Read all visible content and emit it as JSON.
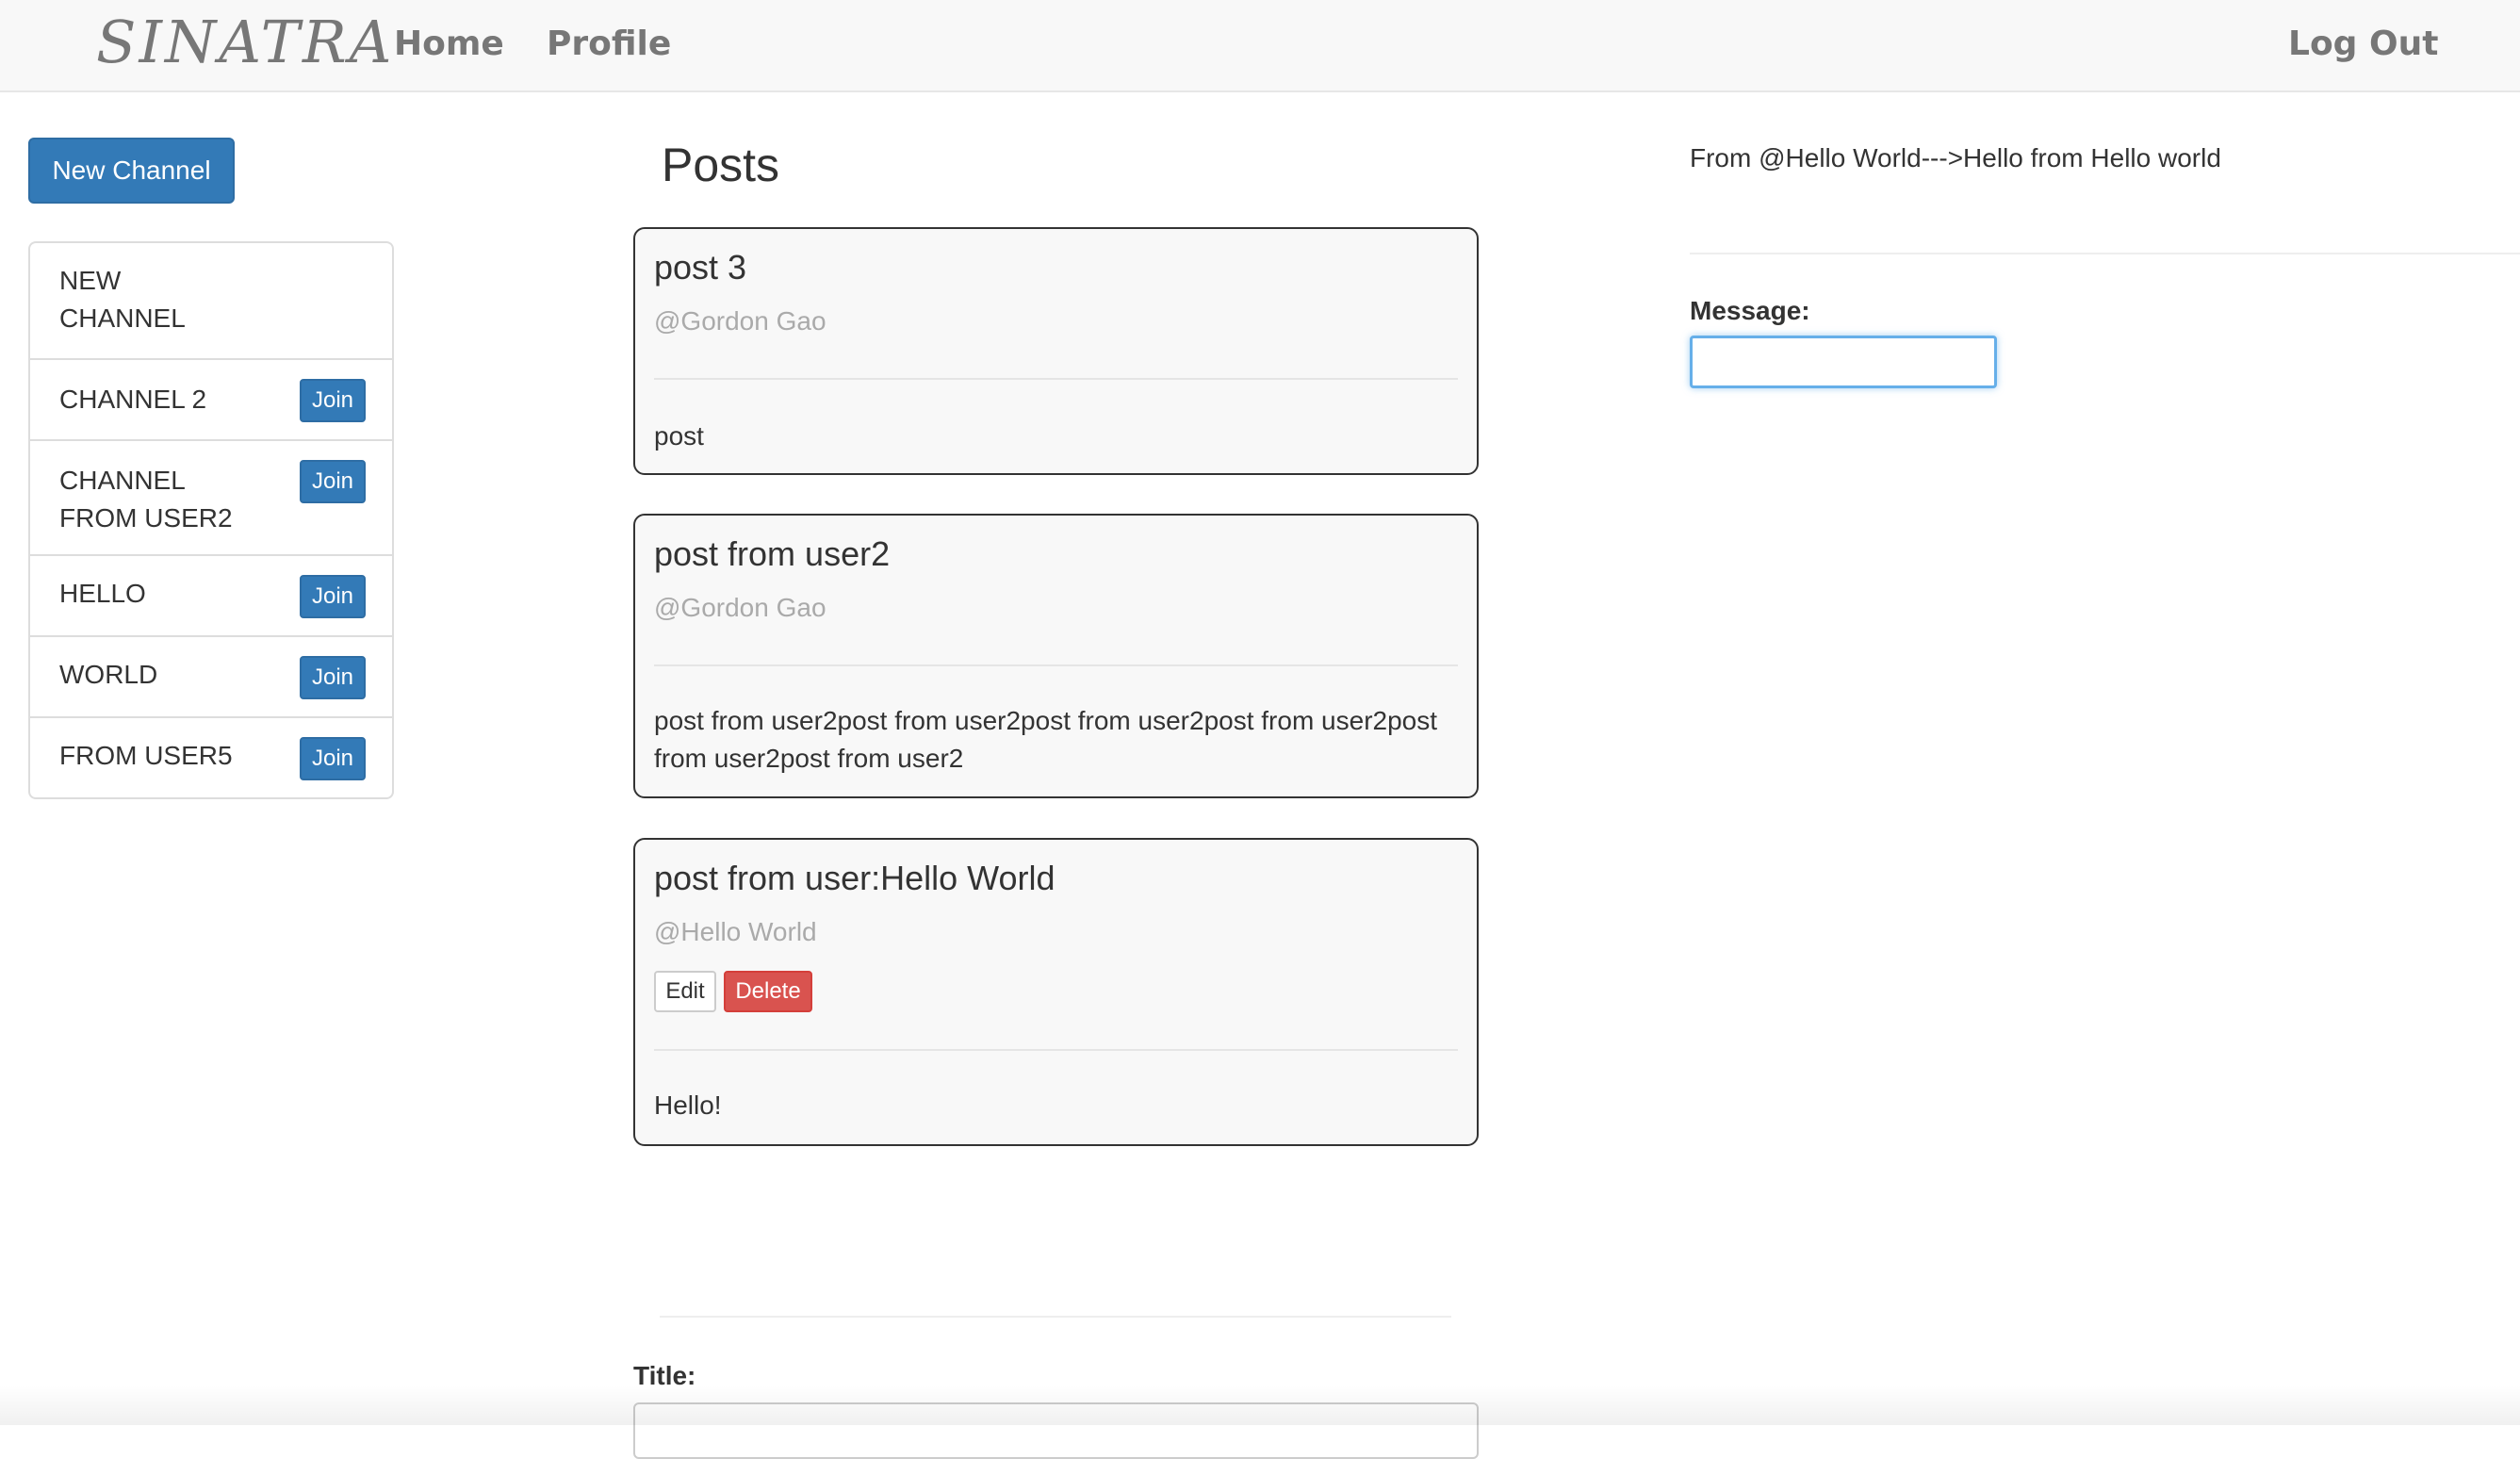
{
  "navbar": {
    "brand": "SINATRA",
    "home_label": "Home",
    "profile_label": "Profile",
    "logout_label": "Log Out"
  },
  "sidebar": {
    "new_channel_label": "New Channel",
    "channels": [
      {
        "name": "NEW\nCHANNEL",
        "join_label": ""
      },
      {
        "name": "CHANNEL 2",
        "join_label": "Join"
      },
      {
        "name": "CHANNEL\nFROM USER2",
        "join_label": "Join"
      },
      {
        "name": "HELLO",
        "join_label": "Join"
      },
      {
        "name": "WORLD",
        "join_label": "Join"
      },
      {
        "name": "FROM USER5",
        "join_label": "Join"
      }
    ]
  },
  "main": {
    "heading": "Posts",
    "posts": [
      {
        "title": "post 3",
        "author": "@Gordon Gao",
        "body": "post"
      },
      {
        "title": "post from user2",
        "author": "@Gordon Gao",
        "body": "post from user2post from user2post from user2post from user2post from user2post from user2"
      },
      {
        "title": "post from user:Hello World",
        "author": "@Hello World",
        "edit_label": "Edit",
        "delete_label": "Delete",
        "body": "Hello!"
      }
    ],
    "form": {
      "title_label": "Title:",
      "title_value": ""
    }
  },
  "chat": {
    "messages": [
      "From @Hello World--->Hello from Hello world"
    ],
    "message_label": "Message:",
    "message_value": ""
  },
  "colors": {
    "primary": "#337ab7",
    "danger": "#d9534f",
    "navbar_bg": "#f8f8f8",
    "nav_text": "#777777",
    "muted_text": "#aaaaaa",
    "focus_border": "#66afe9"
  }
}
